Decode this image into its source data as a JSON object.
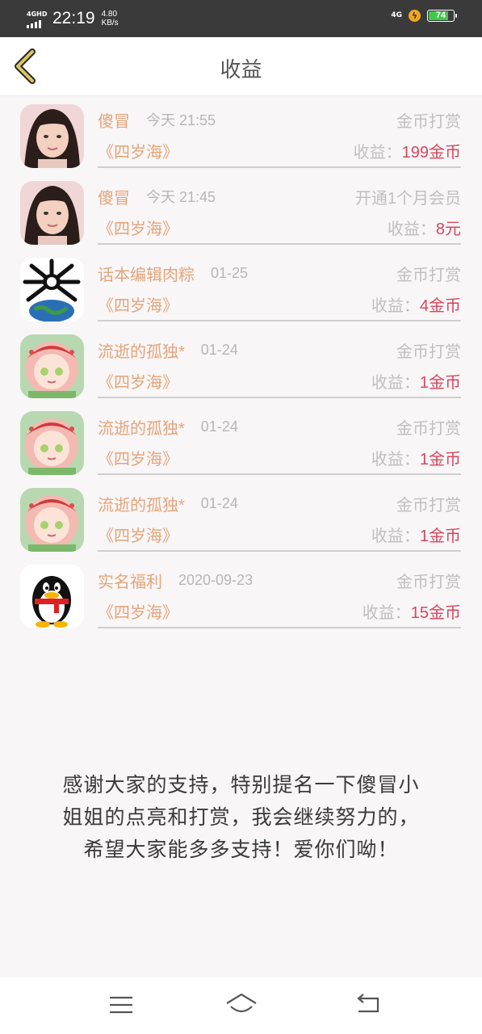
{
  "status": {
    "network": "4GHD",
    "time": "22:19",
    "speed_value": "4.80",
    "speed_unit": "KB/s",
    "net_right": "4G",
    "battery": "74"
  },
  "header": {
    "title": "收益"
  },
  "items": [
    {
      "name": "傻冒",
      "time": "今天 21:55",
      "type": "金币打赏",
      "book": "《四岁海》",
      "income_label": "收益：",
      "income_value": "199金币",
      "avatar": "girl-photo"
    },
    {
      "name": "傻冒",
      "time": "今天 21:45",
      "type": "开通1个月会员",
      "book": "《四岁海》",
      "income_label": "收益：",
      "income_value": "8元",
      "avatar": "girl-photo"
    },
    {
      "name": "话本编辑肉粽",
      "time": "01-25",
      "type": "金币打赏",
      "book": "《四岁海》",
      "income_label": "收益：",
      "income_value": "4金币",
      "avatar": "earth-spider"
    },
    {
      "name": "流逝的孤独*",
      "time": "01-24",
      "type": "金币打赏",
      "book": "《四岁海》",
      "income_label": "收益：",
      "income_value": "1金币",
      "avatar": "anime-christmas"
    },
    {
      "name": "流逝的孤独*",
      "time": "01-24",
      "type": "金币打赏",
      "book": "《四岁海》",
      "income_label": "收益：",
      "income_value": "1金币",
      "avatar": "anime-christmas"
    },
    {
      "name": "流逝的孤独*",
      "time": "01-24",
      "type": "金币打赏",
      "book": "《四岁海》",
      "income_label": "收益：",
      "income_value": "1金币",
      "avatar": "anime-christmas"
    },
    {
      "name": "实名福利",
      "time": "2020-09-23",
      "type": "金币打赏",
      "book": "《四岁海》",
      "income_label": "收益：",
      "income_value": "15金币",
      "avatar": "penguin"
    }
  ],
  "message": {
    "line1": "感谢大家的支持，特别提名一下傻冒小",
    "line2": "姐姐的点亮和打赏，我会继续努力的，",
    "line3": "希望大家能多多支持！爱你们呦！"
  },
  "colors": {
    "name": "#e5a479",
    "value": "#d7455c",
    "muted": "#bfbfbf",
    "battery": "#40c84c"
  }
}
